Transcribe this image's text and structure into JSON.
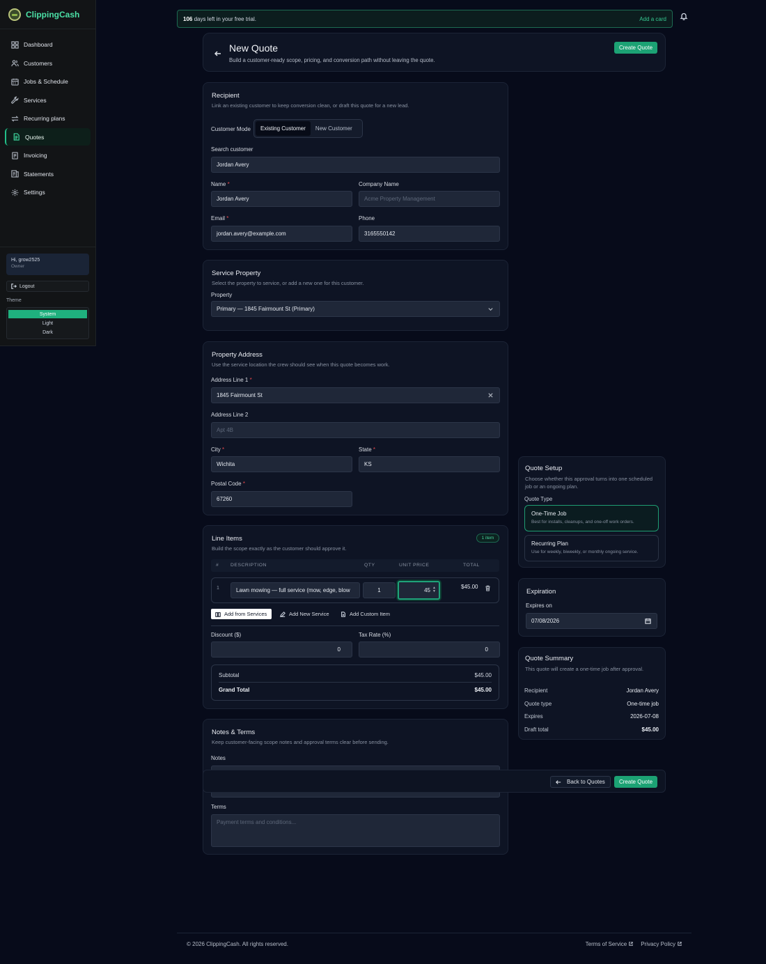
{
  "app": {
    "name": "ClippingCash"
  },
  "sidebar": {
    "items": [
      {
        "label": "Dashboard",
        "icon": "grid-icon"
      },
      {
        "label": "Customers",
        "icon": "users-icon"
      },
      {
        "label": "Jobs & Schedule",
        "icon": "calendar-icon"
      },
      {
        "label": "Services",
        "icon": "wrench-icon"
      },
      {
        "label": "Recurring plans",
        "icon": "repeat-icon"
      },
      {
        "label": "Quotes",
        "icon": "document-icon"
      },
      {
        "label": "Invoicing",
        "icon": "receipt-icon"
      },
      {
        "label": "Statements",
        "icon": "statement-icon"
      },
      {
        "label": "Settings",
        "icon": "gear-icon"
      }
    ],
    "active": "Quotes",
    "user_greeting": "Hi, grow2525",
    "user_role": "Owner",
    "logout_label": "Logout",
    "theme_label": "Theme",
    "theme_options": [
      "System",
      "Light",
      "Dark"
    ],
    "theme_selected": "System"
  },
  "trial": {
    "days": "106",
    "text": "days left in your free trial.",
    "add_card": "Add a card"
  },
  "header": {
    "title": "New Quote",
    "subtitle": "Build a customer-ready scope, pricing, and conversion path without leaving the quote.",
    "create_label": "Create Quote"
  },
  "recipient": {
    "title": "Recipient",
    "subtitle": "Link an existing customer to keep conversion clean, or draft this quote for a new lead.",
    "mode_label": "Customer Mode",
    "mode_options": [
      "Existing Customer",
      "New Customer"
    ],
    "search_label": "Search customer",
    "search_value": "Jordan Avery",
    "name_label": "Name",
    "name_value": "Jordan Avery",
    "company_label": "Company Name",
    "company_placeholder": "Acme Property Management",
    "email_label": "Email",
    "email_value": "jordan.avery@example.com",
    "phone_label": "Phone",
    "phone_value": "3165550142"
  },
  "service_property": {
    "title": "Service Property",
    "subtitle": "Select the property to service, or add a new one for this customer.",
    "property_label": "Property",
    "property_value": "Primary — 1845 Fairmount St (Primary)"
  },
  "address": {
    "title": "Property Address",
    "subtitle": "Use the service location the crew should see when this quote becomes work.",
    "line1_label": "Address Line 1",
    "line1_value": "1845 Fairmount St",
    "line2_label": "Address Line 2",
    "line2_placeholder": "Apt 4B",
    "city_label": "City",
    "city_value": "Wichita",
    "state_label": "State",
    "state_value": "KS",
    "postal_label": "Postal Code",
    "postal_value": "67260"
  },
  "line_items": {
    "title": "Line Items",
    "subtitle": "Build the scope exactly as the customer should approve it.",
    "badge": "1 item",
    "columns": [
      "#",
      "DESCRIPTION",
      "QTY",
      "UNIT PRICE",
      "TOTAL"
    ],
    "rows": [
      {
        "num": "1",
        "description": "Lawn mowing — full service (mow, edge, blow",
        "qty": "1",
        "unit_price": "45",
        "total": "$45.00"
      }
    ],
    "add_from_services": "Add from Services",
    "add_new_service": "Add New Service",
    "add_custom_item": "Add Custom Item",
    "discount_label": "Discount ($)",
    "discount_value": "0",
    "tax_label": "Tax Rate (%)",
    "tax_value": "0",
    "subtotal_label": "Subtotal",
    "subtotal_value": "$45.00",
    "grand_label": "Grand Total",
    "grand_value": "$45.00"
  },
  "notes": {
    "title": "Notes & Terms",
    "subtitle": "Keep customer-facing scope notes and approval terms clear before sending.",
    "notes_label": "Notes",
    "terms_label": "Terms",
    "terms_placeholder": "Payment terms and conditions..."
  },
  "quote_setup": {
    "title": "Quote Setup",
    "subtitle": "Choose whether this approval turns into one scheduled job or an ongoing plan.",
    "type_label": "Quote Type",
    "options": [
      {
        "title": "One-Time Job",
        "desc": "Best for installs, cleanups, and one-off work orders."
      },
      {
        "title": "Recurring Plan",
        "desc": "Use for weekly, biweekly, or monthly ongoing service."
      }
    ],
    "selected": "One-Time Job"
  },
  "expiration": {
    "title": "Expiration",
    "label": "Expires on",
    "value": "07/08/2026"
  },
  "summary": {
    "title": "Quote Summary",
    "subtitle": "This quote will create a one-time job after approval.",
    "rows": [
      {
        "k": "Recipient",
        "v": "Jordan Avery"
      },
      {
        "k": "Quote type",
        "v": "One-time job"
      },
      {
        "k": "Expires",
        "v": "2026-07-08"
      },
      {
        "k": "Draft total",
        "v": "$45.00"
      }
    ]
  },
  "sticky": {
    "back_label": "Back to Quotes",
    "create_label": "Create Quote"
  },
  "footer": {
    "copyright": "© 2026 ClippingCash. All rights reserved.",
    "terms": "Terms of Service",
    "privacy": "Privacy Policy"
  },
  "colors": {
    "accent": "#1ca274",
    "brand": "#4be0a6",
    "required": "#e5484d",
    "background": "#070b1a"
  }
}
